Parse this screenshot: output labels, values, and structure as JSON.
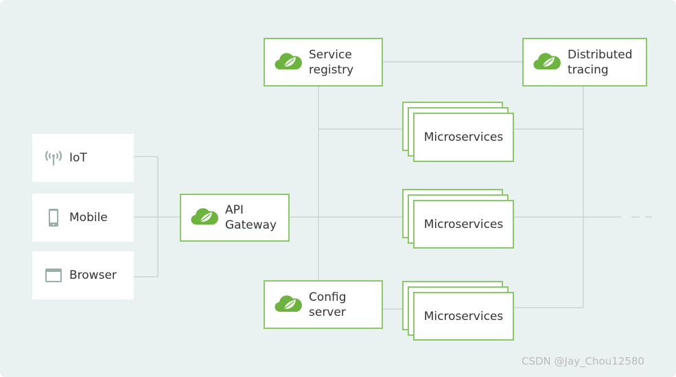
{
  "clients": [
    {
      "label": "IoT",
      "icon": "antenna-icon"
    },
    {
      "label": "Mobile",
      "icon": "mobile-icon"
    },
    {
      "label": "Browser",
      "icon": "browser-icon"
    }
  ],
  "services": {
    "gateway": {
      "line1": "API",
      "line2": "Gateway"
    },
    "registry": {
      "line1": "Service",
      "line2": "registry"
    },
    "tracing": {
      "line1": "Distributed",
      "line2": "tracing"
    },
    "config": {
      "line1": "Config",
      "line2": "server"
    }
  },
  "microservices": [
    "Microservices",
    "Microservices",
    "Microservices"
  ],
  "watermark": "CSDN @Jay_Chou12580",
  "colors": {
    "accent": "#6db33f",
    "background": "#eaf2f1",
    "line": "#c9d4d2",
    "icon": "#9aaeac"
  }
}
